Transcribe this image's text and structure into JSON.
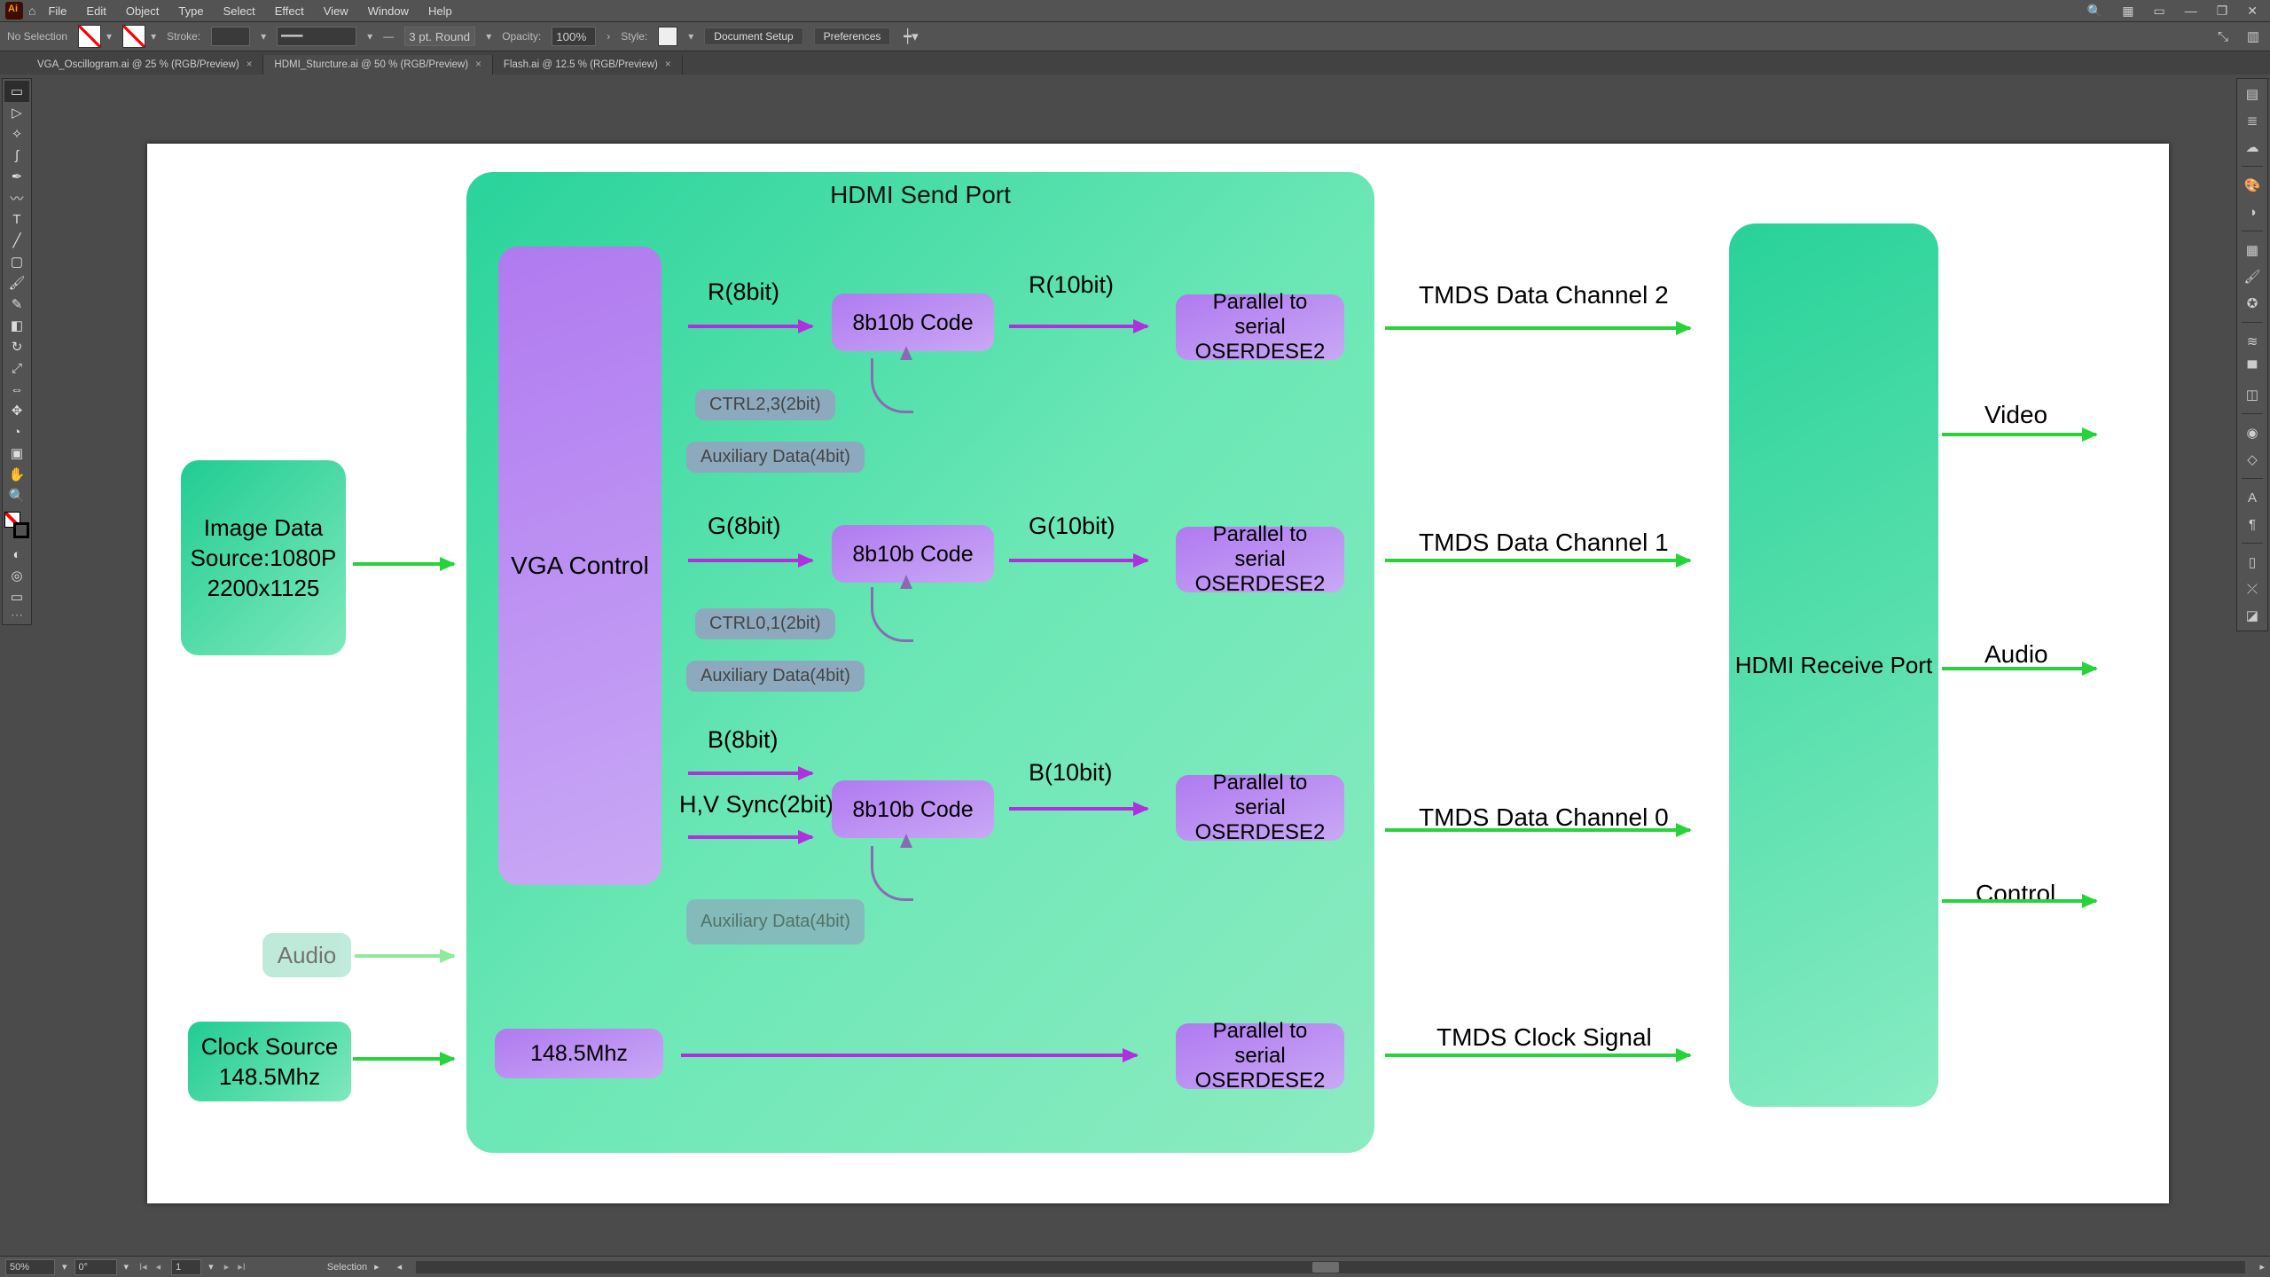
{
  "menu": {
    "items": [
      "File",
      "Edit",
      "Object",
      "Type",
      "Select",
      "Effect",
      "View",
      "Window",
      "Help"
    ]
  },
  "controlbar": {
    "noSelection": "No Selection",
    "strokeLabel": "Stroke:",
    "brush": "3 pt. Round",
    "opacityLabel": "Opacity:",
    "opacityValue": "100%",
    "styleLabel": "Style:",
    "docSetup": "Document Setup",
    "prefs": "Preferences"
  },
  "tabs": [
    {
      "label": "VGA_Oscillogram.ai @ 25 % (RGB/Preview)",
      "active": false
    },
    {
      "label": "HDMI_Sturcture.ai @ 50 % (RGB/Preview)",
      "active": true
    },
    {
      "label": "Flash.ai @ 12.5 % (RGB/Preview)",
      "active": false
    }
  ],
  "status": {
    "zoom": "50%",
    "rotate": "0°",
    "artboardIdx": "1",
    "tool": "Selection"
  },
  "diagram": {
    "sendPortTitle": "HDMI Send Port",
    "recvPortTitle": "HDMI Receive Port",
    "imageSource": {
      "l1": "Image Data",
      "l2": "Source:1080P",
      "l3": "2200x1125"
    },
    "audio": "Audio",
    "clockSource": {
      "l1": "Clock Source",
      "l2": "148.5Mhz"
    },
    "vgaControl": "VGA Control",
    "lanes": {
      "r": {
        "in": "R(8bit)",
        "out": "R(10bit)",
        "ctrl": "CTRL2,3(2bit)",
        "aux": "Auxiliary Data(4bit)",
        "encode": "8b10b Code",
        "pser1": "Parallel to serial",
        "pser2": "OSERDESE2",
        "tmds": "TMDS Data Channel 2"
      },
      "g": {
        "in": "G(8bit)",
        "out": "G(10bit)",
        "ctrl": "CTRL0,1(2bit)",
        "aux": "Auxiliary Data(4bit)",
        "encode": "8b10b Code",
        "pser1": "Parallel to serial",
        "pser2": "OSERDESE2",
        "tmds": "TMDS Data Channel 1"
      },
      "b": {
        "in": "B(8bit)",
        "sync": "H,V Sync(2bit)",
        "out": "B(10bit)",
        "aux": "Auxiliary Data(4bit)",
        "encode": "8b10b Code",
        "pser1": "Parallel to serial",
        "pser2": "OSERDESE2",
        "tmds": "TMDS Data Channel 0"
      }
    },
    "clock": {
      "freq": "148.5Mhz",
      "pser1": "Parallel to serial",
      "pser2": "OSERDESE2",
      "sig": "TMDS Clock Signal"
    },
    "outputs": {
      "video": "Video",
      "audio": "Audio",
      "control": "Control"
    }
  }
}
